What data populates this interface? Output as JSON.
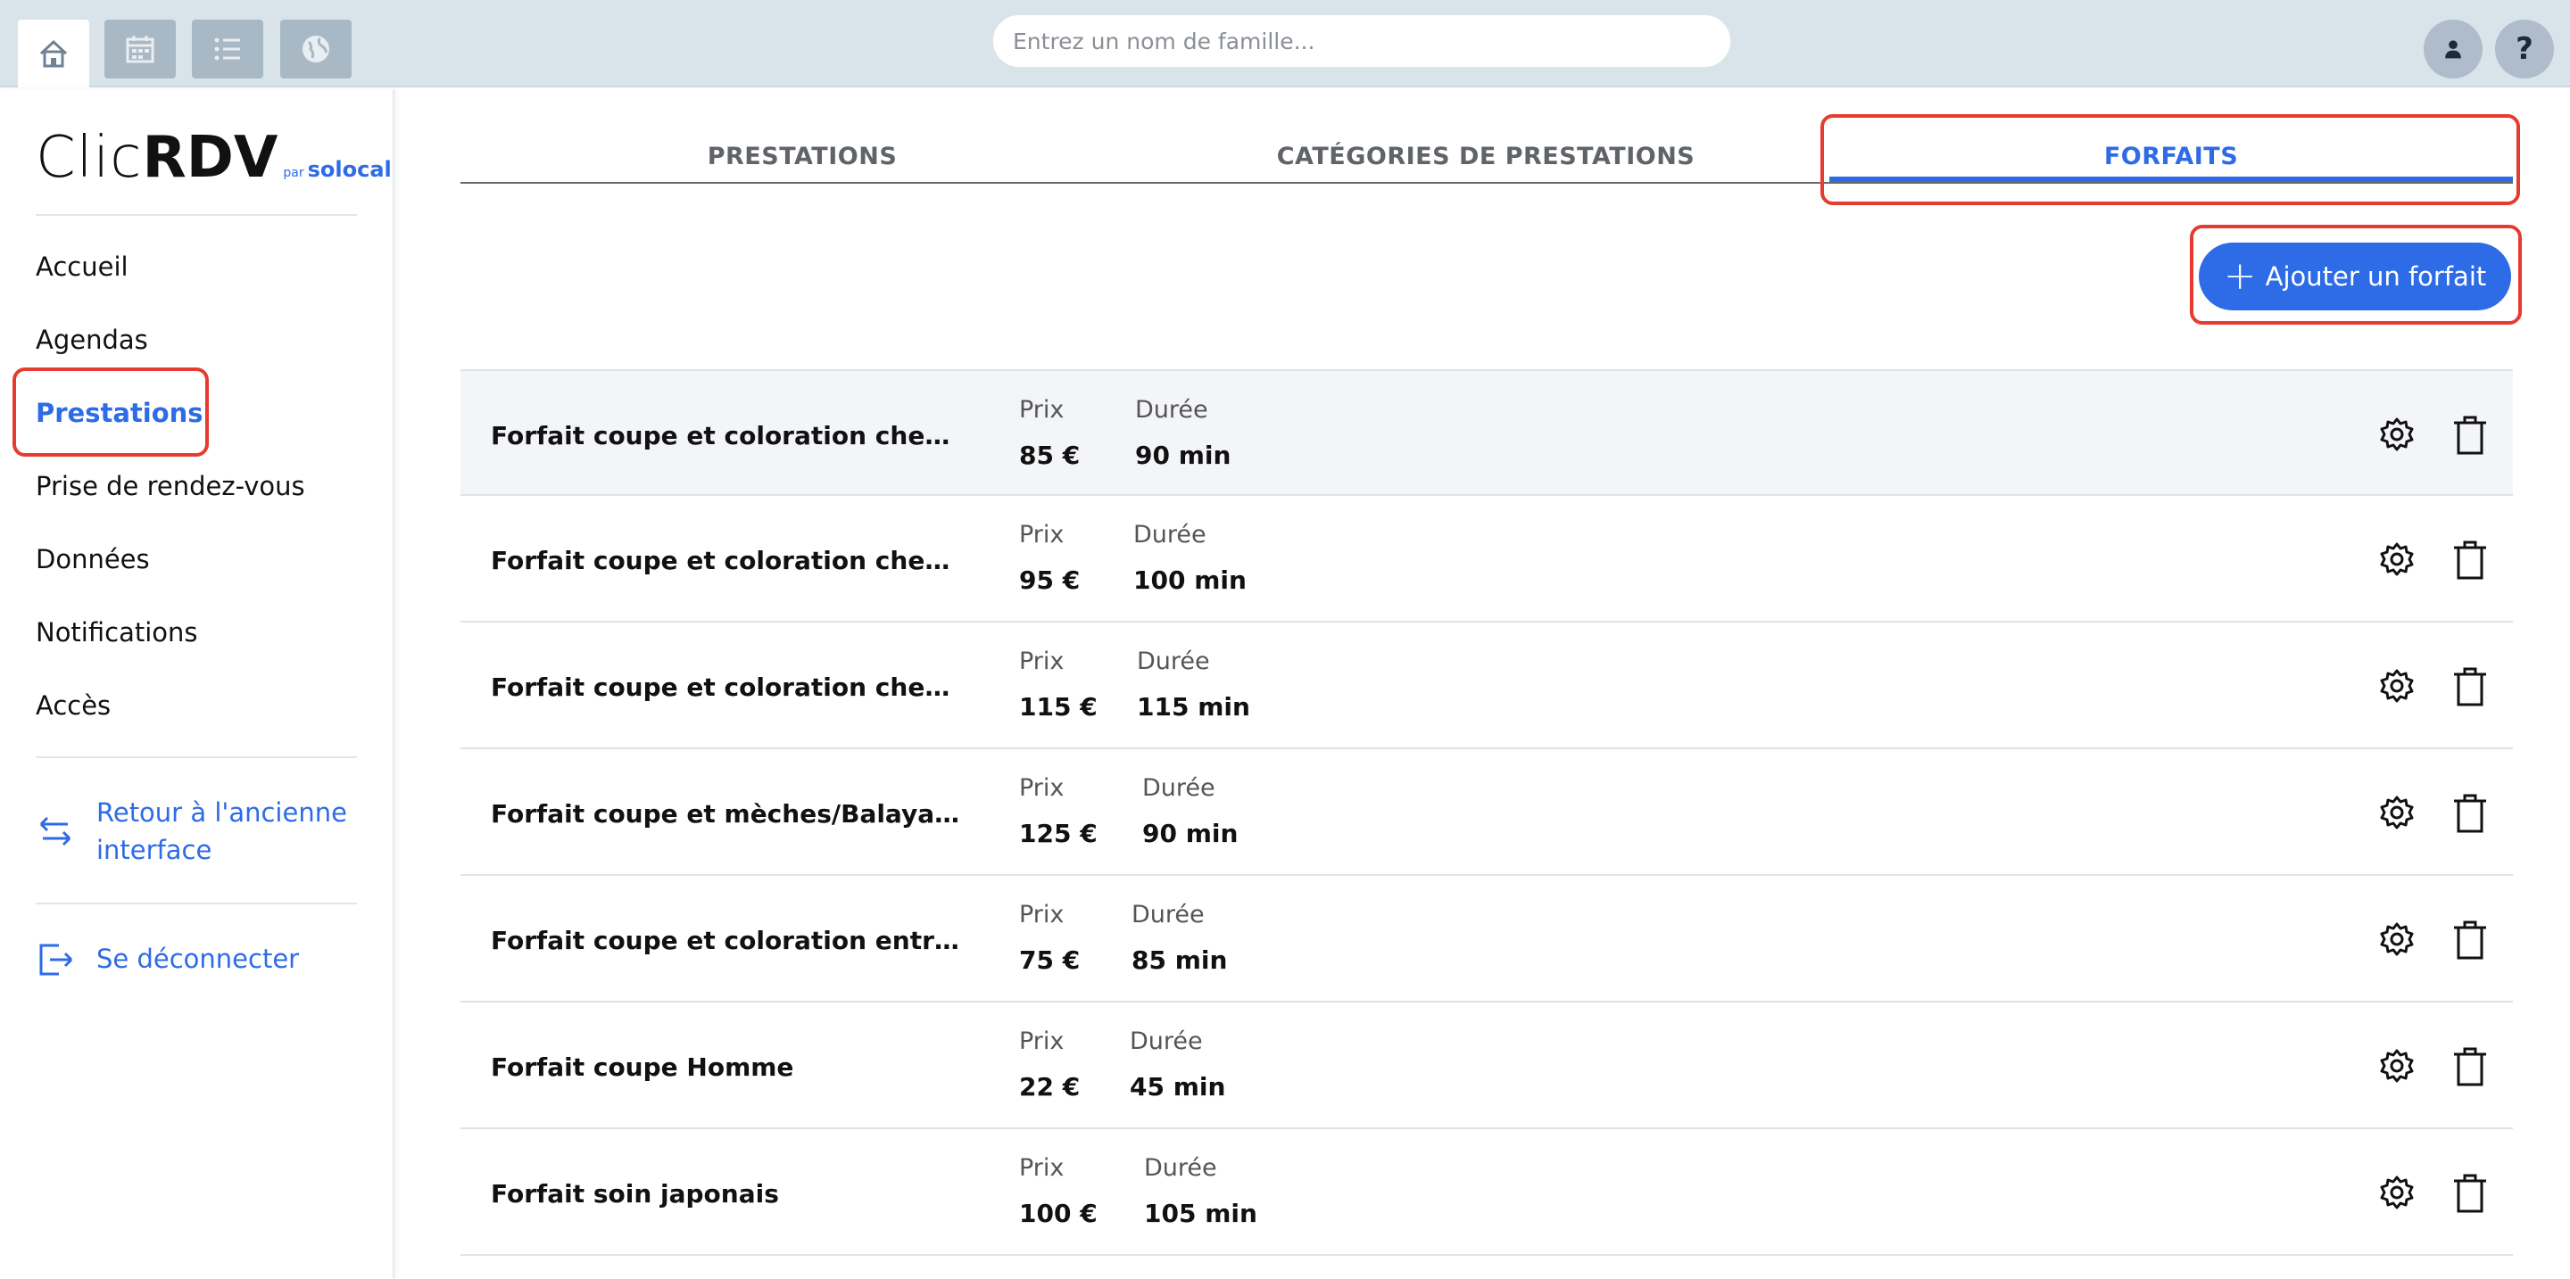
{
  "topbar": {
    "search_placeholder": "Entrez un nom de famille...",
    "help_label": "?"
  },
  "sidebar": {
    "logo": {
      "clic": "Clic",
      "rdv": "RDV",
      "par": "par",
      "solocal": "solocal"
    },
    "nav": [
      "Accueil",
      "Agendas",
      "Prestations",
      "Prise de rendez-vous",
      "Données",
      "Notifications",
      "Accès"
    ],
    "active_item": "Prestations",
    "back_link_line1": "Retour à l'ancienne",
    "back_link_line2": "interface",
    "logout": "Se déconnecter"
  },
  "tabs": [
    "PRESTATIONS",
    "CATÉGORIES DE PRESTATIONS",
    "FORFAITS"
  ],
  "active_tab": "FORFAITS",
  "add_button": "Ajouter un forfait",
  "labels": {
    "price": "Prix",
    "duration": "Durée"
  },
  "forfaits": [
    {
      "name": "Forfait coupe et coloration cheveux courts",
      "display_name": "Forfait coupe et coloration cheveux co...",
      "price": "85 €",
      "duration": "90 min"
    },
    {
      "name": "Forfait coupe et coloration cheveux mi-longs",
      "display_name": "Forfait coupe et coloration cheveux mi...",
      "price": "95 €",
      "duration": "100 min"
    },
    {
      "name": "Forfait coupe et coloration cheveux longs",
      "display_name": "Forfait coupe et coloration cheveux lo...",
      "price": "115 €",
      "duration": "115 min"
    },
    {
      "name": "Forfait coupe et mèches/Balayage/Tie...",
      "display_name": "Forfait coupe et mèches/Balayage/Tie...",
      "price": "125 €",
      "duration": "90 min"
    },
    {
      "name": "Forfait coupe et coloration entretien ra...",
      "display_name": "Forfait coupe et coloration entretien ra...",
      "price": "75 €",
      "duration": "85 min"
    },
    {
      "name": "Forfait coupe Homme",
      "display_name": "Forfait coupe Homme",
      "price": "22 €",
      "duration": "45 min"
    },
    {
      "name": "Forfait soin japonais",
      "display_name": "Forfait soin japonais",
      "price": "100 €",
      "duration": "105 min"
    }
  ],
  "colors": {
    "accent": "#2e6be6",
    "highlight": "#e63b2e",
    "topbar": "#d9e3ea"
  }
}
